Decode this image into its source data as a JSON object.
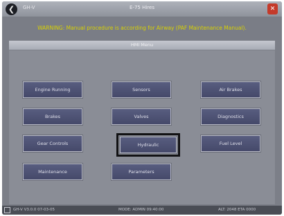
{
  "titlebar": {
    "back_label": "❮",
    "left_text": "GH-V",
    "title": "E-75 Hires",
    "close_label": "✕"
  },
  "warning": {
    "text": "WARNING: Manual procedure is according for Airway (PAF Maintenance Manual)."
  },
  "section": {
    "title": "HMI Menu"
  },
  "menu": {
    "items": [
      {
        "label": "Engine Running"
      },
      {
        "label": "Sensors"
      },
      {
        "label": "Air Brakes"
      },
      {
        "label": "Brakes"
      },
      {
        "label": "Valves"
      },
      {
        "label": "Diagnostics"
      },
      {
        "label": "Gear Controls"
      },
      {
        "label": "Hydraulic"
      },
      {
        "label": "Fuel Level"
      },
      {
        "label": "Maintenance"
      },
      {
        "label": "Parameters"
      }
    ],
    "selected": "Hydraulic"
  },
  "statusbar": {
    "left": "GH-V   V3.0.0   07-03-05",
    "center": "MODE: ADMIN  09:40:00",
    "right": "ALT: 2048  ETA  0000"
  }
}
